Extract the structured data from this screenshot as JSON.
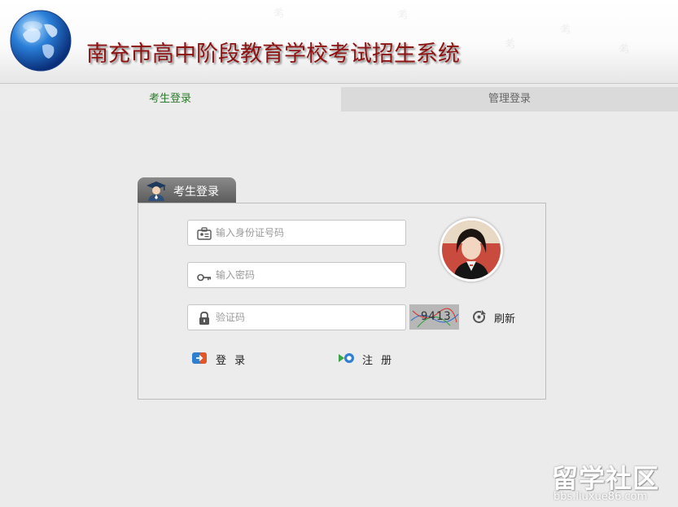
{
  "header": {
    "title": "南充市高中阶段教育学校考试招生系统",
    "watermark_glyph": "考"
  },
  "tabs": [
    {
      "label": "考生登录",
      "active": true
    },
    {
      "label": "管理登录",
      "active": false
    }
  ],
  "login_panel": {
    "tab_label": "考生登录",
    "id_field": {
      "placeholder": "输入身份证号码",
      "value": ""
    },
    "password_field": {
      "placeholder": "输入密码",
      "value": ""
    },
    "captcha_field": {
      "placeholder": "验证码",
      "value": ""
    },
    "captcha_text": "9413",
    "refresh_label": "刷新",
    "login_label": "登 录",
    "register_label": "注 册"
  },
  "watermark_logo": {
    "big": "留学社区",
    "small": "bbs.liuxue86.com"
  },
  "icons": {
    "logo": "globe-icon",
    "tab": "student-graduate-icon",
    "id": "id-card-icon",
    "password": "key-icon",
    "captcha": "lock-icon",
    "refresh": "refresh-icon",
    "login": "login-icon",
    "register": "register-icon"
  },
  "colors": {
    "title": "#8e1313",
    "active_tab_text": "#2c7a2c",
    "inactive_tab_bg": "#dadada",
    "page_bg": "#ebebeb"
  }
}
